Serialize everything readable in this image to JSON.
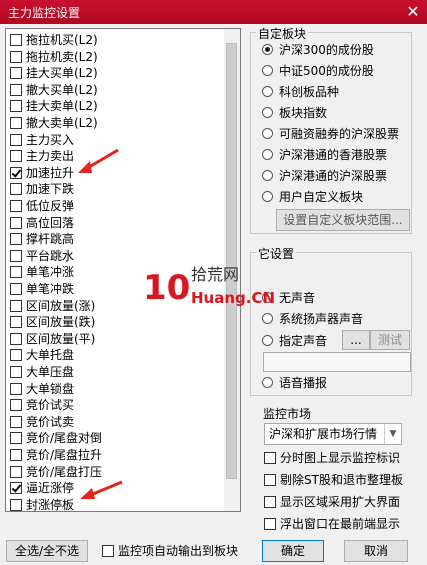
{
  "window": {
    "title": "主力监控设置",
    "close_label": "✕"
  },
  "monitor_list": [
    {
      "label": "拖拉机买(L2)",
      "checked": false
    },
    {
      "label": "拖拉机卖(L2)",
      "checked": false
    },
    {
      "label": "挂大买单(L2)",
      "checked": false
    },
    {
      "label": "撤大买单(L2)",
      "checked": false
    },
    {
      "label": "挂大卖单(L2)",
      "checked": false
    },
    {
      "label": "撤大卖单(L2)",
      "checked": false
    },
    {
      "label": "主力买入",
      "checked": false
    },
    {
      "label": "主力卖出",
      "checked": false
    },
    {
      "label": "加速拉升",
      "checked": true
    },
    {
      "label": "加速下跌",
      "checked": false
    },
    {
      "label": "低位反弹",
      "checked": false
    },
    {
      "label": "高位回落",
      "checked": false
    },
    {
      "label": "撑杆跳高",
      "checked": false
    },
    {
      "label": "平台跳水",
      "checked": false
    },
    {
      "label": "单笔冲涨",
      "checked": false
    },
    {
      "label": "单笔冲跌",
      "checked": false
    },
    {
      "label": "区间放量(涨)",
      "checked": false
    },
    {
      "label": "区间放量(跌)",
      "checked": false
    },
    {
      "label": "区间放量(平)",
      "checked": false
    },
    {
      "label": "大单托盘",
      "checked": false
    },
    {
      "label": "大单压盘",
      "checked": false
    },
    {
      "label": "大单锁盘",
      "checked": false
    },
    {
      "label": "竞价试买",
      "checked": false
    },
    {
      "label": "竞价试卖",
      "checked": false
    },
    {
      "label": "竞价/尾盘对倒",
      "checked": false
    },
    {
      "label": "竞价/尾盘拉升",
      "checked": false
    },
    {
      "label": "竞价/尾盘打压",
      "checked": false
    },
    {
      "label": "逼近涨停",
      "checked": true
    },
    {
      "label": "封涨停板",
      "checked": false
    }
  ],
  "custom_sector": {
    "group_label": "自定板块",
    "options": [
      {
        "label": "沪深300的成份股",
        "selected": true
      },
      {
        "label": "中证500的成份股",
        "selected": false
      },
      {
        "label": "科创板品种",
        "selected": false
      },
      {
        "label": "板块指数",
        "selected": false
      },
      {
        "label": "可融资融券的沪深股票",
        "selected": false
      },
      {
        "label": "沪深港通的香港股票",
        "selected": false
      },
      {
        "label": "沪深港通的沪深股票",
        "selected": false
      },
      {
        "label": "用户自定义板块",
        "selected": false
      }
    ],
    "set_range_button": "设置自定义板块范围..."
  },
  "sound": {
    "group_label": "它设置",
    "options": [
      {
        "label": "无声音",
        "selected": false
      },
      {
        "label": "系统扬声器声音",
        "selected": false
      },
      {
        "label": "指定声音",
        "selected": false
      },
      {
        "label": "语音播报",
        "selected": false
      }
    ],
    "browse_button": "...",
    "test_button": "测试"
  },
  "market": {
    "label": "监控市场",
    "selected": "沪深和扩展市场行情"
  },
  "display_options": [
    {
      "label": "分时图上显示监控标识",
      "checked": false
    },
    {
      "label": "剔除ST股和退市整理板",
      "checked": false
    },
    {
      "label": "显示区域采用扩大界面",
      "checked": false
    },
    {
      "label": "浮出窗口在最前端显示",
      "checked": false
    }
  ],
  "footer": {
    "select_all_button": "全选/全不选",
    "auto_output_label": "监控项自动输出到板块",
    "ok_button": "确定",
    "cancel_button": "取消"
  },
  "watermark": {
    "brand": "拾荒网",
    "site": "Huang.CN",
    "logo_digits": "10"
  },
  "colors": {
    "title_bar": "#c8102e",
    "arrow": "#e8231c"
  }
}
